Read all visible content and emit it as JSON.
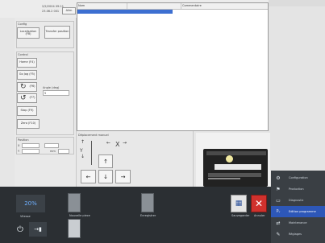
{
  "header": {
    "info_line1": "2/2/2004 09:11",
    "info_line2": "23.06.2 001",
    "info_button": "Alim"
  },
  "left_panel": {
    "section1_title": "Config",
    "btn_a": "Localisation (F8)",
    "btn_b": "Transfer position",
    "section2_title": "Control",
    "btn_home": "Home (F4)",
    "btn_move": "Go Jog (F5)",
    "btn_rotate_cw": "(F6)",
    "btn_rotate_ccw": "(F7)",
    "step_label": "Angle (deg)",
    "step_value": "5",
    "btn_stop": "Stop (F9)",
    "btn_zero": "Zero (F10)",
    "section3_title": "Position",
    "pos_label_x": "X",
    "pos_label_y": "Y",
    "pos_value_x": "",
    "pos_value_y": "",
    "pos_unit": "mm"
  },
  "table": {
    "columns": [
      "Nom",
      "",
      "Commentaire"
    ],
    "rows": [
      {
        "col1": "",
        "col2": "",
        "col3": ""
      }
    ]
  },
  "jog": {
    "title": "Déplacement manuel",
    "x_label": "X",
    "y_label": "Y"
  },
  "toolbar": {
    "zoom_value": "20%",
    "zoom_label": "Vitesse",
    "tile1_label": "Nouvelle piece",
    "tile2_label": "Enregistrer",
    "save_label": "Sauvegarder",
    "cancel_label": "Annuler"
  },
  "nav": {
    "items": [
      {
        "icon": "gear-icon",
        "label": "Configuration"
      },
      {
        "icon": "flag-icon",
        "label": "Production"
      },
      {
        "icon": "monitor-icon",
        "label": "Diagnostic"
      },
      {
        "icon": "program-icon",
        "label": "Edition programme",
        "active": true
      },
      {
        "icon": "tools-icon",
        "label": "Maintenance"
      },
      {
        "icon": "wrench-icon",
        "label": "Réglages"
      }
    ]
  },
  "colors": {
    "toolbar_bg": "#2b2f33",
    "nav_bg": "#3a3f44",
    "nav_active": "#2d57b8",
    "selection": "#3d6fd1"
  }
}
